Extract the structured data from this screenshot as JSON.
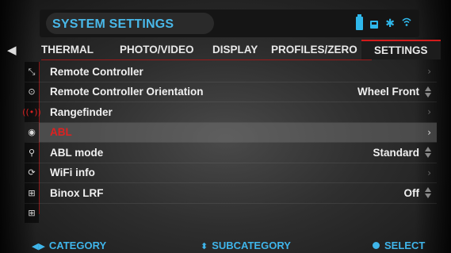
{
  "header": {
    "title": "SYSTEM SETTINGS",
    "status_icons": [
      "battery-icon",
      "sd-card-icon",
      "bluetooth-icon",
      "wifi-icon"
    ],
    "accent_color": "#49b8e9"
  },
  "tabs": [
    {
      "label": "THERMAL",
      "active": false
    },
    {
      "label": "PHOTO/VIDEO",
      "active": false
    },
    {
      "label": "DISPLAY",
      "active": false
    },
    {
      "label": "PROFILES/ZERO",
      "active": false
    },
    {
      "label": "SETTINGS",
      "active": true
    }
  ],
  "menu": [
    {
      "icon": "remote-controller-icon",
      "label": "Remote Controller",
      "value": "",
      "control": "chevron"
    },
    {
      "icon": "orientation-icon",
      "label": "Remote Controller Orientation",
      "value": "Wheel Front",
      "control": "updown"
    },
    {
      "icon": "rangefinder-icon",
      "label": "Rangefinder",
      "value": "",
      "control": "chevron"
    },
    {
      "icon": "abl-icon",
      "label": "ABL",
      "value": "",
      "control": "chevron",
      "selected": true
    },
    {
      "icon": "search-icon",
      "label": "ABL mode",
      "value": "Standard",
      "control": "updown"
    },
    {
      "icon": "refresh-icon",
      "label": "WiFi info",
      "value": "",
      "control": "chevron"
    },
    {
      "icon": "chip-icon",
      "label": "Binox LRF",
      "value": "Off",
      "control": "updown"
    },
    {
      "icon": "chip-icon",
      "label": "",
      "value": "",
      "control": "none"
    }
  ],
  "footer": {
    "category": "CATEGORY",
    "subcategory": "SUBCATEGORY",
    "select": "SELECT"
  },
  "colors": {
    "selected_text": "#e02020",
    "tab_indicator": "#d21b1b",
    "footer_text": "#3fb5ea"
  }
}
